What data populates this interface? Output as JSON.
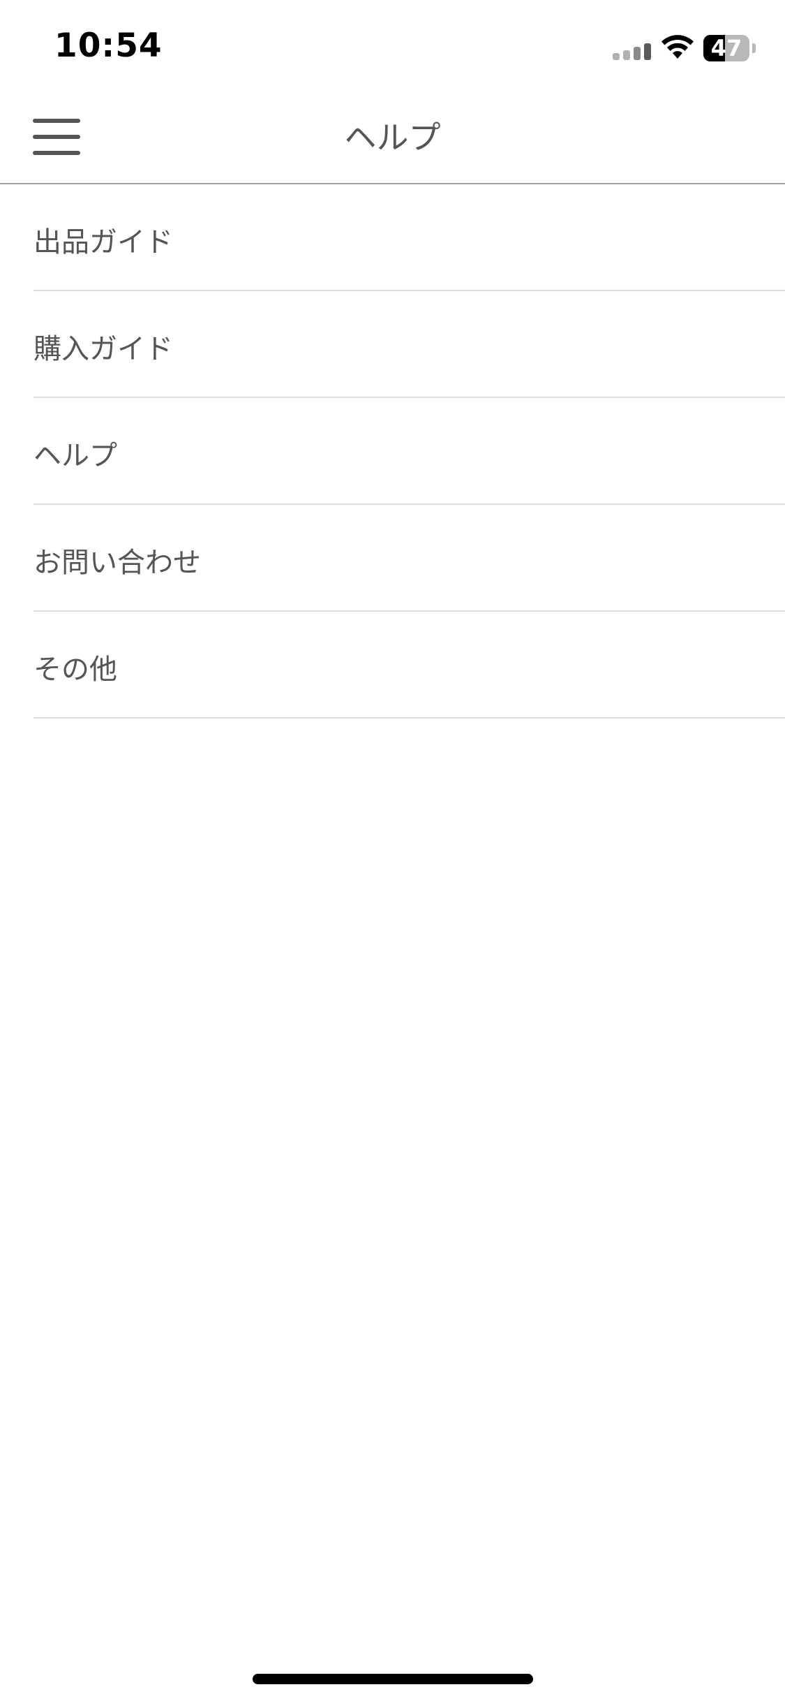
{
  "status_bar": {
    "time": "10:54",
    "battery_level": "47",
    "battery_fraction": 0.47,
    "signal_bars_active": 2,
    "signal_bars_total": 4,
    "icons": [
      "signal-icon",
      "wifi-icon",
      "battery-icon"
    ]
  },
  "header": {
    "title": "ヘルプ",
    "menu_icon": "hamburger-menu-icon"
  },
  "menu": {
    "items": [
      {
        "label": "出品ガイド"
      },
      {
        "label": "購入ガイド"
      },
      {
        "label": "ヘルプ"
      },
      {
        "label": "お問い合わせ"
      },
      {
        "label": "その他"
      }
    ]
  },
  "colors": {
    "text": "#555555",
    "divider": "#dcdcdc",
    "header_border": "#a3a3a3",
    "background": "#ffffff"
  }
}
